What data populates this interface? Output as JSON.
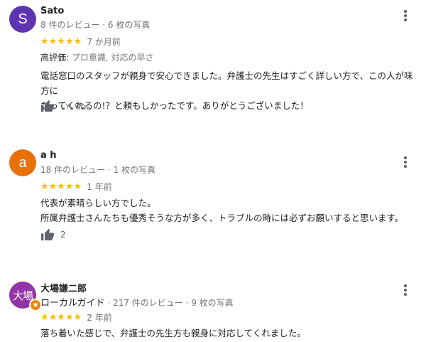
{
  "reviews": [
    {
      "avatar_text": "S",
      "avatar_color": "#5e35b1",
      "name": "Sato",
      "meta": "8 件のレビュー · 6 枚の写真",
      "stars": "★★★★★",
      "date": "7 か月前",
      "attr_label": "高評価:",
      "attr_value": " プロ意識, 対応の早さ",
      "line1": "電話窓口のスタッフが親身で安心できました。弁護士の先生はすごく詳しい方で、この人が味方に",
      "line2": "なってくれるの!？と頼もしかったです。ありがとうございました！",
      "like_label": "いいね",
      "more_icon": "more-vert-icon"
    },
    {
      "avatar_text": "a",
      "avatar_color": "#e8710a",
      "name": "a h",
      "meta": "18 件のレビュー · 1 枚の写真",
      "stars": "★★★★★",
      "date": "1 年前",
      "line1": "代表が素晴らしい方でした。",
      "line2": "所属弁護士さんたちも優秀そうな方が多く、トラブルの時には必ずお願いすると思います。",
      "like_count": "2"
    },
    {
      "avatar_text": "大場",
      "avatar_color": "#9334a6",
      "name": "大場謙二郎",
      "guide": "ローカルガイド",
      "meta": " · 217 件のレビュー · 9 枚の写真",
      "stars": "★★★★★",
      "date": "2 年前",
      "line1": "落ち着いた感じで、弁護士の先生方も親身に対応してくれました。"
    }
  ],
  "colors": {
    "star": "#fbbc04",
    "secondary_text": "#70757a",
    "primary_text": "#202124"
  }
}
